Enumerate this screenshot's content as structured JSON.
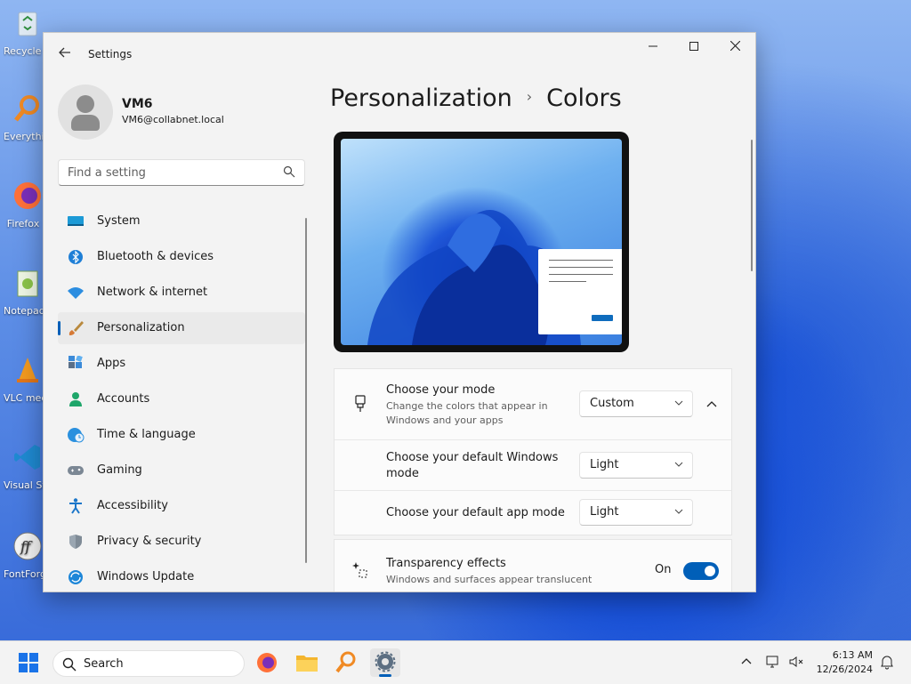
{
  "desktop": {
    "icons": [
      {
        "label": "Recycle Bin"
      },
      {
        "label": "Everything"
      },
      {
        "label": "Firefox"
      },
      {
        "label": "Notepad++"
      },
      {
        "label": "VLC media player"
      },
      {
        "label": "Visual Studio Code"
      },
      {
        "label": "FontForge"
      }
    ]
  },
  "window": {
    "title": "Settings",
    "controls": {
      "minimize": "—",
      "maximize": "☐",
      "close": "✕"
    }
  },
  "profile": {
    "name": "VM6",
    "email": "VM6@collabnet.local"
  },
  "search": {
    "placeholder": "Find a setting"
  },
  "sidebar": {
    "items": [
      {
        "label": "System",
        "icon": "system-icon",
        "active": false
      },
      {
        "label": "Bluetooth & devices",
        "icon": "bluetooth-icon",
        "active": false
      },
      {
        "label": "Network & internet",
        "icon": "wifi-icon",
        "active": false
      },
      {
        "label": "Personalization",
        "icon": "brush-icon",
        "active": true
      },
      {
        "label": "Apps",
        "icon": "apps-icon",
        "active": false
      },
      {
        "label": "Accounts",
        "icon": "person-icon",
        "active": false
      },
      {
        "label": "Time & language",
        "icon": "globe-clock-icon",
        "active": false
      },
      {
        "label": "Gaming",
        "icon": "gamepad-icon",
        "active": false
      },
      {
        "label": "Accessibility",
        "icon": "accessibility-icon",
        "active": false
      },
      {
        "label": "Privacy & security",
        "icon": "shield-icon",
        "active": false
      },
      {
        "label": "Windows Update",
        "icon": "update-icon",
        "active": false
      }
    ]
  },
  "breadcrumb": {
    "parent": "Personalization",
    "separator": "›",
    "current": "Colors"
  },
  "mode_card": {
    "title": "Choose your mode",
    "description": "Change the colors that appear in Windows and your apps",
    "value": "Custom",
    "sub_rows": [
      {
        "title": "Choose your default Windows mode",
        "value": "Light"
      },
      {
        "title": "Choose your default app mode",
        "value": "Light"
      }
    ]
  },
  "transparency_card": {
    "title": "Transparency effects",
    "description": "Windows and surfaces appear translucent",
    "state_label": "On",
    "enabled": true
  },
  "taskbar": {
    "search_label": "Search",
    "time": "6:13 AM",
    "date": "12/26/2024"
  },
  "colors": {
    "accent": "#005fb8",
    "window_bg": "#f3f3f3",
    "card_bg": "#fbfbfb"
  }
}
